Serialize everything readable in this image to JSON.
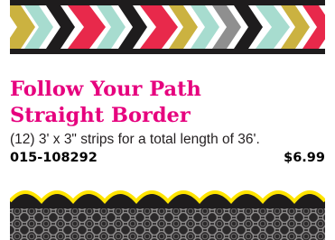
{
  "product": {
    "title_line1": "Follow Your Path",
    "title_line2": "Straight Border",
    "description": "(12) 3' x 3\" strips for a total length of 36'.",
    "sku": "015-108292",
    "price": "$6.99",
    "image_icon": "chevron-border-image"
  },
  "next_product": {
    "image_icon": "scalloped-border-image"
  },
  "colors": {
    "title": "#e6007e",
    "text": "#231f20",
    "chevron_red": "#e8294b",
    "chevron_mint": "#a7dccf",
    "chevron_gold": "#cbb240",
    "chevron_gray": "#8f8f8f",
    "border_black": "#1e1c1d",
    "scallop_yellow": "#ffe400"
  }
}
